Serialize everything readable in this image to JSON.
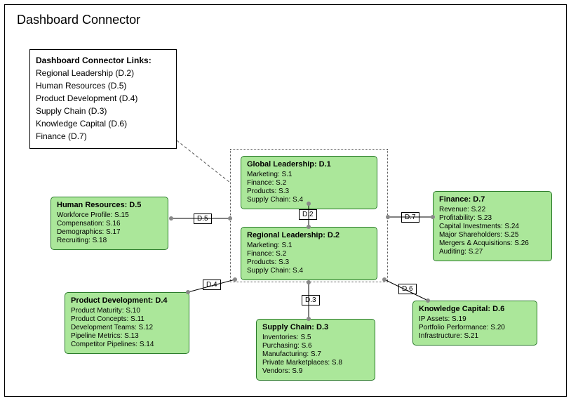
{
  "title": "Dashboard Connector",
  "links_panel": {
    "heading": "Dashboard Connector Links:",
    "items": [
      "Regional Leadership (D.2)",
      "Human Resources (D.5)",
      "Product Development (D.4)",
      "Supply Chain (D.3)",
      "Knowledge Capital (D.6)",
      "Finance (D.7)"
    ]
  },
  "nodes": {
    "d1": {
      "title": "Global Leadership: D.1",
      "items": [
        "Marketing: S.1",
        "Finance: S.2",
        "Products: S.3",
        "Supply Chain: S.4"
      ]
    },
    "d2": {
      "title": "Regional Leadership: D.2",
      "items": [
        "Marketing: S.1",
        "Finance: S.2",
        "Products: S.3",
        "Supply Chain: S.4"
      ]
    },
    "d3": {
      "title": "Supply Chain: D.3",
      "items": [
        "Inventories: S.5",
        "Purchasing: S.6",
        "Manufacturing: S.7",
        "Private Marketplaces: S.8",
        "Vendors: S.9"
      ]
    },
    "d4": {
      "title": "Product Development: D.4",
      "items": [
        "Product Maturity: S.10",
        "Product Concepts: S.11",
        "Development Teams: S.12",
        "Pipeline Metrics: S.13",
        "Competitor Pipelines: S.14"
      ]
    },
    "d5": {
      "title": "Human Resources: D.5",
      "items": [
        "Workforce Profile: S.15",
        "Compensation: S.16",
        "Demographics: S.17",
        "Recruiting: S.18"
      ]
    },
    "d6": {
      "title": "Knowledge Capital: D.6",
      "items": [
        "IP Assets: S.19",
        "Portfolio Performance: S.20",
        "Infrastructure: S.21"
      ]
    },
    "d7": {
      "title": "Finance: D.7",
      "items": [
        "Revenue: S.22",
        "Profitability: S.23",
        "Capital Investments: S.24",
        "Major Shareholders: S.25",
        "Mergers & Acquisitions: S.26",
        "Auditing: S.27"
      ]
    }
  },
  "edge_labels": {
    "d2": "D.2",
    "d3": "D.3",
    "d4": "D.4",
    "d5": "D.5",
    "d6": "D.6",
    "d7": "D.7"
  },
  "colors": {
    "node_fill": "#abe79a",
    "node_border": "#2a7a2a"
  }
}
